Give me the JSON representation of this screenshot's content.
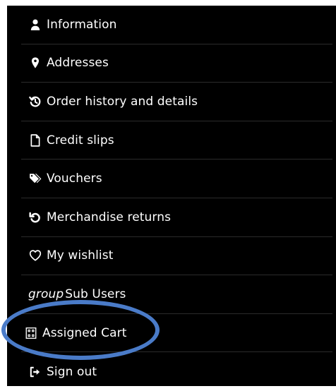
{
  "menu": {
    "items": [
      {
        "icon": "user-icon",
        "label": "Information"
      },
      {
        "icon": "map-marker-icon",
        "label": "Addresses"
      },
      {
        "icon": "history-icon",
        "label": "Order history and details"
      },
      {
        "icon": "file-icon",
        "label": "Credit slips"
      },
      {
        "icon": "tags-icon",
        "label": "Vouchers"
      },
      {
        "icon": "undo-icon",
        "label": "Merchandise returns"
      },
      {
        "icon": "heart-outline-icon",
        "label": "My wishlist"
      },
      {
        "icon": "group-icon",
        "icon_text": "group",
        "label": "Sub Users"
      },
      {
        "icon": "barcode-icon",
        "label": "Assigned Cart"
      },
      {
        "icon": "sign-out-icon",
        "label": "Sign out"
      }
    ]
  },
  "annotation": {
    "highlight_color": "#4a7bc8"
  },
  "colors": {
    "background": "#000000",
    "text": "#ffffff",
    "divider": "#2b2b2b"
  }
}
